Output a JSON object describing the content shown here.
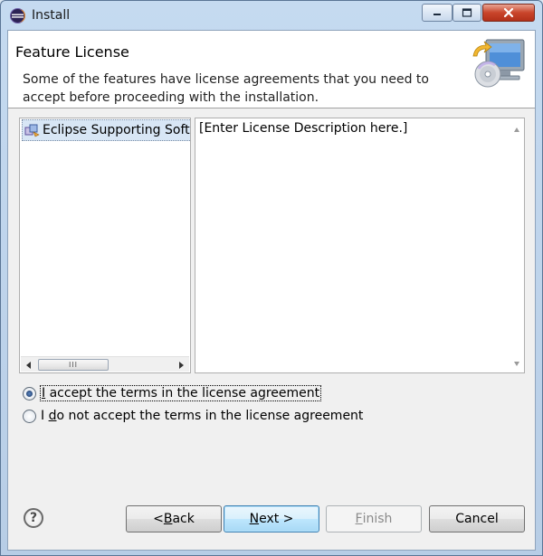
{
  "window": {
    "title": "Install",
    "title_icon": "eclipse-icon",
    "controls": [
      "minimize-icon",
      "maximize-icon",
      "close-icon"
    ]
  },
  "banner": {
    "title": "Feature License",
    "description": "Some of the features have license agreements that you need to accept before proceeding with the installation.",
    "art_icon": "install-monitor-cd-icon"
  },
  "features": {
    "items": [
      {
        "label": "Eclipse Supporting Softw",
        "icon": "feature-plugin-icon",
        "selected": true
      }
    ],
    "scrollbar": {
      "left_icon": "left-arrow-icon",
      "right_icon": "right-arrow-icon",
      "thumb_grip": "III"
    }
  },
  "license": {
    "text": "[Enter License Description here.]",
    "scroll_up_icon": "up-arrow-icon",
    "scroll_down_icon": "down-arrow-icon"
  },
  "agreement": {
    "accept": {
      "mnemonic": "I",
      "pre": "",
      "rest": " accept the terms in the license agreement",
      "checked": true
    },
    "decline": {
      "pre": "I ",
      "mnemonic": "d",
      "rest": "o not accept the terms in the license agreement",
      "checked": false
    }
  },
  "footer": {
    "help_icon": "help-icon",
    "help_glyph": "?",
    "back": {
      "pre": "< ",
      "mnemonic": "B",
      "rest": "ack"
    },
    "next": {
      "mnemonic": "N",
      "rest": "ext >"
    },
    "finish": {
      "mnemonic": "F",
      "rest": "inish",
      "enabled": false
    },
    "cancel": {
      "label": "Cancel"
    }
  },
  "colors": {
    "frame": "#c5daf0",
    "close_button": "#c9452b",
    "primary_button": "#bee6fd",
    "selection": "#d8e6f5"
  }
}
